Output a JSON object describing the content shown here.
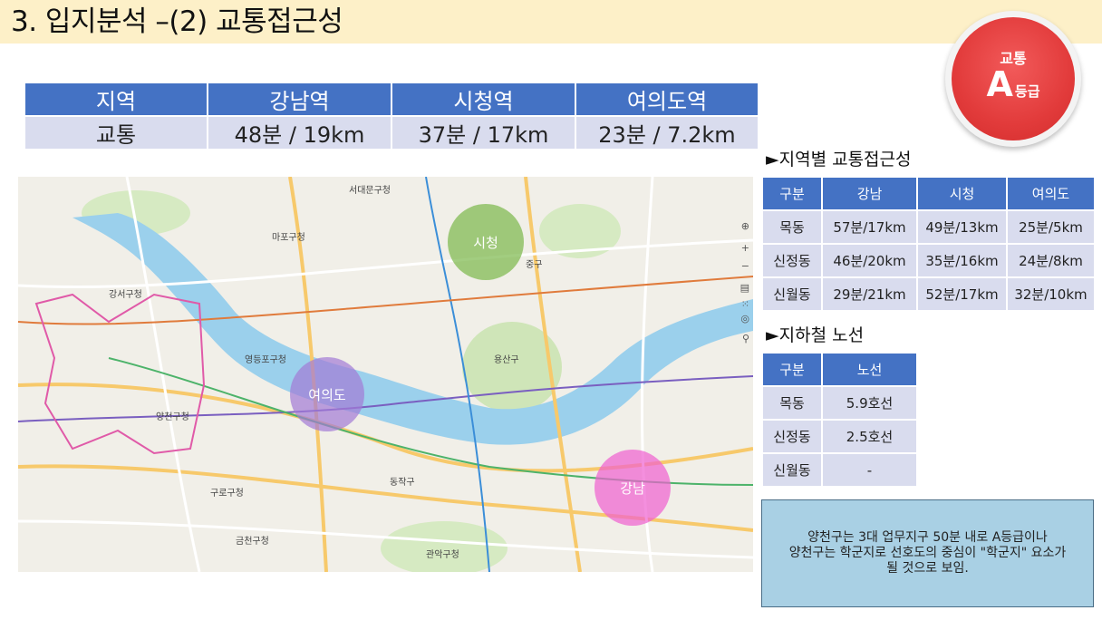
{
  "header": {
    "title": "3. 입지분석 –(2) 교통접근성"
  },
  "badge": {
    "top": "교통",
    "grade": "A",
    "grade_suffix": "등급"
  },
  "summary_table": {
    "headers": [
      "지역",
      "강남역",
      "시청역",
      "여의도역"
    ],
    "row": [
      "교통",
      "48분 / 19km",
      "37분 / 17km",
      "23분 / 7.2km"
    ]
  },
  "map": {
    "circles": [
      {
        "label": "시청",
        "color": "#7bb84a"
      },
      {
        "label": "여의도",
        "color": "#a27ad6"
      },
      {
        "label": "강남",
        "color": "#f060d0"
      }
    ],
    "places": [
      "강서구청",
      "양천구청",
      "구로구청",
      "관악구청",
      "용산구",
      "동작구",
      "마포구청",
      "서대문구청",
      "영등포구청",
      "중구",
      "금천구청"
    ],
    "controls": [
      "⊕",
      "+",
      "−",
      "▤",
      "⁙",
      "◎",
      "⚲"
    ]
  },
  "access_section": {
    "title": "►지역별 교통접근성",
    "headers": [
      "구분",
      "강남",
      "시청",
      "여의도"
    ],
    "rows": [
      [
        "목동",
        "57분/17km",
        "49분/13km",
        "25분/5km"
      ],
      [
        "신정동",
        "46분/20km",
        "35분/16km",
        "24분/8km"
      ],
      [
        "신월동",
        "29분/21km",
        "52분/17km",
        "32분/10km"
      ]
    ]
  },
  "subway_section": {
    "title": "►지하철 노선",
    "headers": [
      "구분",
      "노선"
    ],
    "rows": [
      [
        "목동",
        "5.9호선"
      ],
      [
        "신정동",
        "2.5호선"
      ],
      [
        "신월동",
        "-"
      ]
    ]
  },
  "note": {
    "line1": "양천구는 3대 업무지구 50분 내로 A등급이나",
    "line2": "양천구는 학군지로 선호도의 중심이 \"학군지\" 요소가",
    "line3": "될 것으로 보임."
  }
}
